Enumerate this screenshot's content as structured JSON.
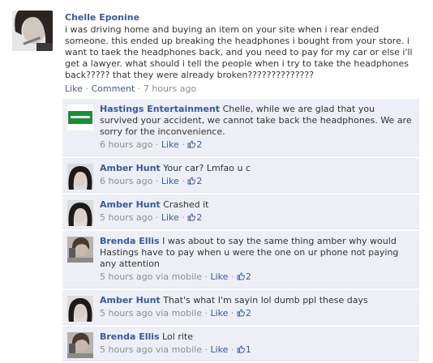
{
  "post": {
    "author": "Chelle Eponine",
    "text": "i was driving home and buying an item on your site when i rear ended someone. this ended up breaking the headphones i bought from your store. i want to taek the headphones back, and you need to pay for my car or else i'll get a lawyer. what should i tell the people when i try to take the headphones back????? that they were already broken??????????????",
    "like_label": "Like",
    "comment_label": "Comment",
    "time": "7 hours ago",
    "separator": "·"
  },
  "comments": [
    {
      "author": "Hastings Entertainment",
      "text": "Chelle, while we are glad that you survived your accident, we cannot take back the headphones. We are sorry for the inconvenience.",
      "time": "6 hours ago",
      "like_label": "Like",
      "likes": "2",
      "avatar": "hastings-logo"
    },
    {
      "author": "Amber Hunt",
      "text": "Your car? Lmfao u c",
      "time": "6 hours ago",
      "like_label": "Like",
      "likes": "2",
      "avatar": "amber"
    },
    {
      "author": "Amber Hunt",
      "text": "Crashed it",
      "time": "5 hours ago",
      "like_label": "Like",
      "likes": "2",
      "avatar": "amber"
    },
    {
      "author": "Brenda Ellis",
      "text": "I was about to say the same thing amber why would Hastings have to pay when u were the one on ur phone not paying any attention",
      "time": "5 hours ago via mobile",
      "like_label": "Like",
      "likes": "2",
      "avatar": "brenda"
    },
    {
      "author": "Amber Hunt",
      "text": "That's what I'm sayin lol dumb ppl these days",
      "time": "5 hours ago via mobile",
      "like_label": "Like",
      "likes": "2",
      "avatar": "amber"
    },
    {
      "author": "Brenda Ellis",
      "text": "Lol rite",
      "time": "5 hours ago via mobile",
      "like_label": "Like",
      "likes": "1",
      "avatar": "brenda"
    }
  ],
  "colors": {
    "link": "#3b5998",
    "comment_bg": "#eceff5",
    "meta_gray": "#8d8d8d"
  }
}
